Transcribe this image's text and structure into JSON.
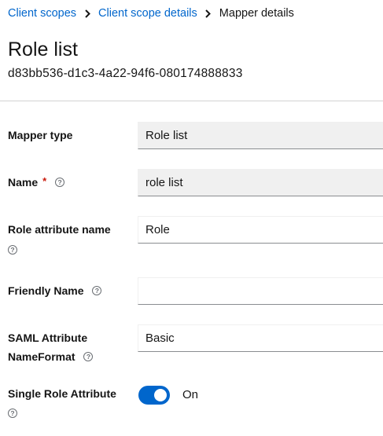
{
  "breadcrumb": {
    "items": [
      {
        "label": "Client scopes"
      },
      {
        "label": "Client scope details"
      }
    ],
    "current": "Mapper details"
  },
  "header": {
    "title": "Role list",
    "subtitle": "d83bb536-d1c3-4a22-94f6-080174888833"
  },
  "form": {
    "mapper_type": {
      "label": "Mapper type",
      "value": "Role list"
    },
    "name": {
      "label": "Name",
      "required_mark": "*",
      "value": "role list"
    },
    "role_attribute_name": {
      "label": "Role attribute name",
      "value": "Role"
    },
    "friendly_name": {
      "label": "Friendly Name",
      "value": ""
    },
    "saml_nameformat": {
      "label_line1": "SAML Attribute",
      "label_line2": "NameFormat",
      "value": "Basic"
    },
    "single_role_attribute": {
      "label": "Single Role Attribute",
      "state_label": "On",
      "enabled": true
    }
  },
  "icons": {
    "help": "question-circle-icon",
    "separator": "angle-right-icon"
  },
  "colors": {
    "link": "#0066cc",
    "switch_on": "#0066cc",
    "required": "#c9190b"
  }
}
